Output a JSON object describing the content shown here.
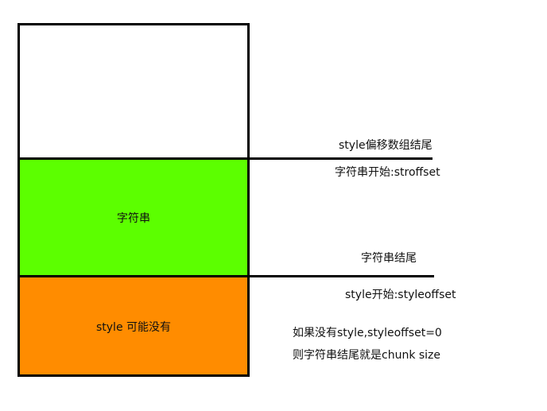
{
  "blocks": {
    "top": {
      "label": "",
      "color": "#ffffff"
    },
    "strings": {
      "label": "字符串",
      "color": "#5cff00"
    },
    "styles": {
      "label": "style 可能没有",
      "color": "#ff8c00"
    }
  },
  "annotations": {
    "style_offset_end": "style偏移数组结尾",
    "string_start": "字符串开始:stroffset",
    "string_end": "字符串结尾",
    "style_start": "style开始:styleoffset",
    "note_line1": "如果没有style,styleoffset=0",
    "note_line2": "则字符串结尾就是chunk size"
  }
}
